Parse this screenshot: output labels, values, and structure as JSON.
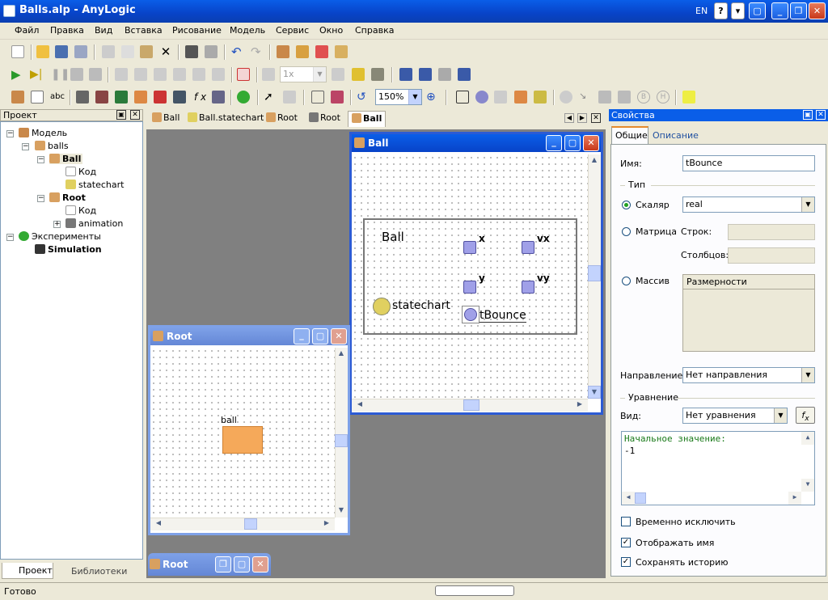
{
  "app": {
    "title": "Balls.alp - AnyLogic",
    "lang": "EN"
  },
  "menu": [
    "Файл",
    "Правка",
    "Вид",
    "Вставка",
    "Рисование",
    "Модель",
    "Сервис",
    "Окно",
    "Справка"
  ],
  "toolbar": {
    "speed": "1x",
    "zoom": "150%",
    "abc": "abc",
    "fx": "f x"
  },
  "project": {
    "header": "Проект",
    "tree": [
      {
        "label": "Модель",
        "bold": false
      },
      {
        "label": "balls",
        "bold": false
      },
      {
        "label": "Ball",
        "bold": true
      },
      {
        "label": "Код",
        "bold": false
      },
      {
        "label": "statechart",
        "bold": false
      },
      {
        "label": "Root",
        "bold": true
      },
      {
        "label": "Код",
        "bold": false
      },
      {
        "label": "animation",
        "bold": false
      },
      {
        "label": "Эксперименты",
        "bold": false
      },
      {
        "label": "Simulation",
        "bold": true
      }
    ],
    "bottom_tabs": [
      "Проект",
      "Библиотеки"
    ]
  },
  "editor_tabs": [
    "Ball",
    "Ball.statechart",
    "Root",
    "Root",
    "Ball"
  ],
  "ball_window": {
    "title": "Ball",
    "frame_label": "Ball",
    "vars": [
      "x",
      "vx",
      "y",
      "vy"
    ],
    "statechart": "statechart",
    "event": "tBounce"
  },
  "root_window": {
    "title": "Root",
    "object_label": "ball",
    "object_color": "#f5a95a"
  },
  "root_min": {
    "title": "Root"
  },
  "properties": {
    "header": "Свойства",
    "tabs": [
      "Общие",
      "Описание"
    ],
    "name_label": "Имя:",
    "name_value": "tBounce",
    "type_group": "Тип",
    "scalar": "Скаляр",
    "scalar_type": "real",
    "matrix": "Матрица",
    "rows": "Строк:",
    "cols": "Столбцов:",
    "array": "Массив",
    "dims": "Размерности",
    "direction_label": "Направление:",
    "direction_value": "Нет направления",
    "equation_group": "Уравнение",
    "kind_label": "Вид:",
    "kind_value": "Нет уравнения",
    "initial_label": "Начальное значение:",
    "initial_value": "-1",
    "exclude": "Временно исключить",
    "show_name": "Отображать имя",
    "keep_history": "Сохранять историю",
    "show_name_checked": true,
    "keep_history_checked": true,
    "exclude_checked": false
  },
  "status": {
    "text": "Готово"
  }
}
